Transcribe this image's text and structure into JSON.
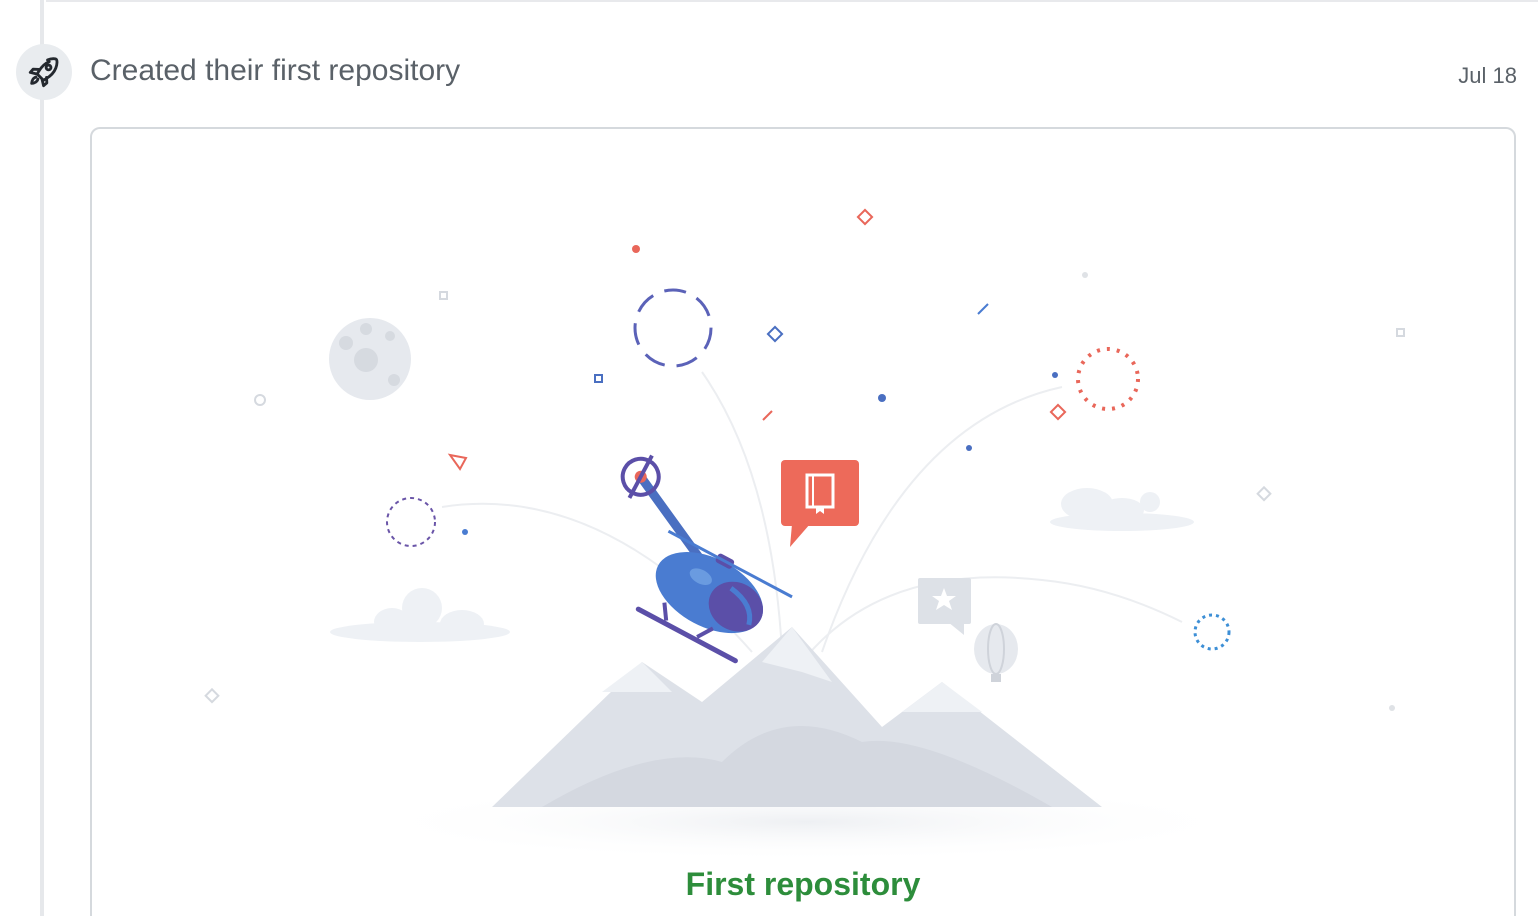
{
  "event": {
    "title": "Created their first repository",
    "date": "Jul 18",
    "icon": "rocket-icon"
  },
  "card": {
    "caption": "First repository",
    "illustration": "helicopter-mountain-illustration"
  },
  "colors": {
    "caption": "#2d8d3b",
    "accent_red": "#e9675a",
    "accent_blue": "#4a7cd1",
    "accent_purple": "#5b4fa8"
  }
}
